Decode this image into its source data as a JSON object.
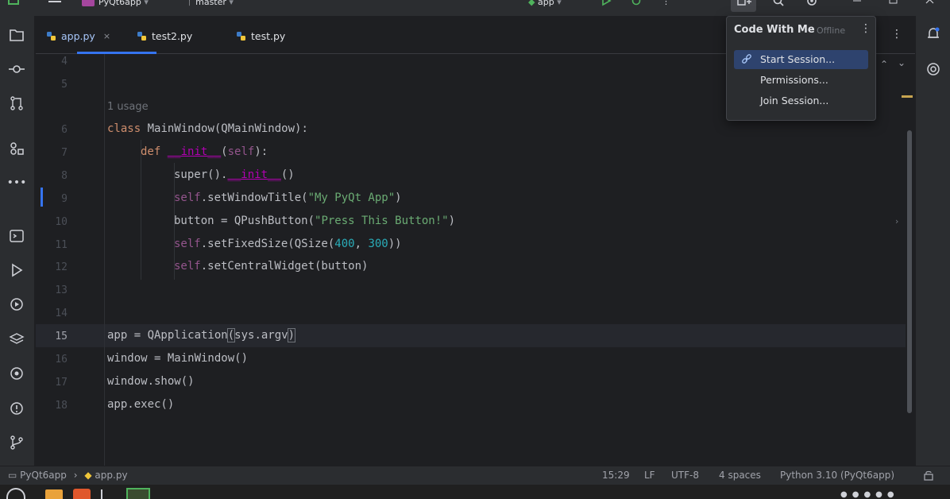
{
  "titlebar": {
    "project_name": "PyQt6app",
    "branch": "master",
    "run_config": "app"
  },
  "tabs": [
    {
      "label": "app.py",
      "close": "×"
    },
    {
      "label": "test2.py"
    },
    {
      "label": "test.py"
    }
  ],
  "editor": {
    "line_numbers": [
      "4",
      "5",
      "6",
      "7",
      "8",
      "9",
      "10",
      "11",
      "12",
      "13",
      "14",
      "15",
      "16",
      "17",
      "18"
    ],
    "usage_hint": "1 usage",
    "code": {
      "l6_kw": "class",
      "l6_rest": " MainWindow(QMainWindow):",
      "l7_kw": "def",
      "l7_fn": "__init__",
      "l7_open": "(",
      "l7_self": "self",
      "l7_close": "):",
      "l8_a": "super().",
      "l8_dunder": "__init__",
      "l8_b": "()",
      "l9_self": "self",
      "l9_a": ".setWindowTitle(",
      "l9_str": "\"My PyQt App\"",
      "l9_b": ")",
      "l10_a": "button = QPushButton(",
      "l10_str": "\"Press This Button!\"",
      "l10_b": ")",
      "l11_self": "self",
      "l11_a": ".setFixedSize(QSize(",
      "l11_n1": "400",
      "l11_sep": ", ",
      "l11_n2": "300",
      "l11_b": "))",
      "l12_self": "self",
      "l12_a": ".setCentralWidget(button)",
      "l15_a": "app = QApplication",
      "l15_open": "(",
      "l15_mid": "sys.argv",
      "l15_close": ")",
      "l16": "window = MainWindow()",
      "l17": "window.show()",
      "l18": "app.exec()"
    }
  },
  "popup": {
    "title": "Code With Me",
    "status": "Offline",
    "more": "⋮",
    "items": [
      {
        "label": "Start Session..."
      },
      {
        "label": "Permissions..."
      },
      {
        "label": "Join Session..."
      }
    ]
  },
  "statusbar": {
    "crumb_project": "PyQt6app",
    "crumb_sep": "›",
    "crumb_file": "app.py",
    "position": "15:29",
    "line_ending": "LF",
    "encoding": "UTF-8",
    "indent": "4 spaces",
    "interpreter": "Python 3.10 (PyQt6app)"
  },
  "colors": {
    "accent": "#3574f0",
    "project_badge": "#a5469e",
    "popup_selected": "#2e436e"
  }
}
